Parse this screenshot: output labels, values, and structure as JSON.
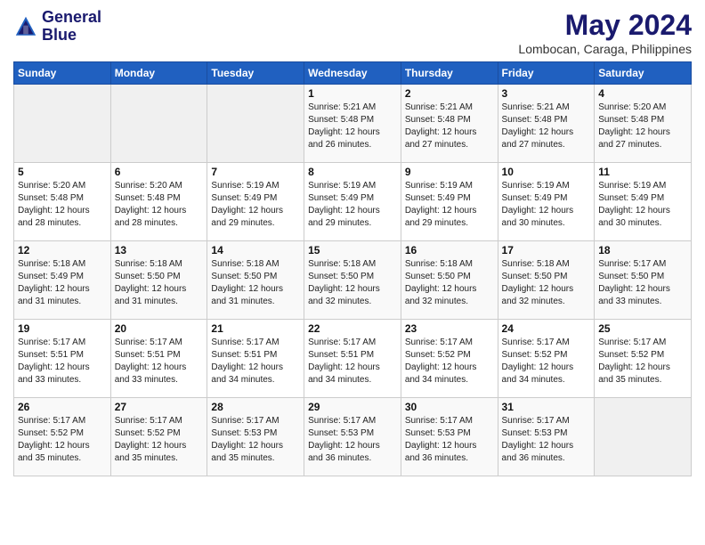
{
  "header": {
    "logo_line1": "General",
    "logo_line2": "Blue",
    "month": "May 2024",
    "location": "Lombocan, Caraga, Philippines"
  },
  "weekdays": [
    "Sunday",
    "Monday",
    "Tuesday",
    "Wednesday",
    "Thursday",
    "Friday",
    "Saturday"
  ],
  "weeks": [
    [
      {
        "day": "",
        "sunrise": "",
        "sunset": "",
        "daylight": ""
      },
      {
        "day": "",
        "sunrise": "",
        "sunset": "",
        "daylight": ""
      },
      {
        "day": "",
        "sunrise": "",
        "sunset": "",
        "daylight": ""
      },
      {
        "day": "1",
        "sunrise": "Sunrise: 5:21 AM",
        "sunset": "Sunset: 5:48 PM",
        "daylight": "Daylight: 12 hours and 26 minutes."
      },
      {
        "day": "2",
        "sunrise": "Sunrise: 5:21 AM",
        "sunset": "Sunset: 5:48 PM",
        "daylight": "Daylight: 12 hours and 27 minutes."
      },
      {
        "day": "3",
        "sunrise": "Sunrise: 5:21 AM",
        "sunset": "Sunset: 5:48 PM",
        "daylight": "Daylight: 12 hours and 27 minutes."
      },
      {
        "day": "4",
        "sunrise": "Sunrise: 5:20 AM",
        "sunset": "Sunset: 5:48 PM",
        "daylight": "Daylight: 12 hours and 27 minutes."
      }
    ],
    [
      {
        "day": "5",
        "sunrise": "Sunrise: 5:20 AM",
        "sunset": "Sunset: 5:48 PM",
        "daylight": "Daylight: 12 hours and 28 minutes."
      },
      {
        "day": "6",
        "sunrise": "Sunrise: 5:20 AM",
        "sunset": "Sunset: 5:48 PM",
        "daylight": "Daylight: 12 hours and 28 minutes."
      },
      {
        "day": "7",
        "sunrise": "Sunrise: 5:19 AM",
        "sunset": "Sunset: 5:49 PM",
        "daylight": "Daylight: 12 hours and 29 minutes."
      },
      {
        "day": "8",
        "sunrise": "Sunrise: 5:19 AM",
        "sunset": "Sunset: 5:49 PM",
        "daylight": "Daylight: 12 hours and 29 minutes."
      },
      {
        "day": "9",
        "sunrise": "Sunrise: 5:19 AM",
        "sunset": "Sunset: 5:49 PM",
        "daylight": "Daylight: 12 hours and 29 minutes."
      },
      {
        "day": "10",
        "sunrise": "Sunrise: 5:19 AM",
        "sunset": "Sunset: 5:49 PM",
        "daylight": "Daylight: 12 hours and 30 minutes."
      },
      {
        "day": "11",
        "sunrise": "Sunrise: 5:19 AM",
        "sunset": "Sunset: 5:49 PM",
        "daylight": "Daylight: 12 hours and 30 minutes."
      }
    ],
    [
      {
        "day": "12",
        "sunrise": "Sunrise: 5:18 AM",
        "sunset": "Sunset: 5:49 PM",
        "daylight": "Daylight: 12 hours and 31 minutes."
      },
      {
        "day": "13",
        "sunrise": "Sunrise: 5:18 AM",
        "sunset": "Sunset: 5:50 PM",
        "daylight": "Daylight: 12 hours and 31 minutes."
      },
      {
        "day": "14",
        "sunrise": "Sunrise: 5:18 AM",
        "sunset": "Sunset: 5:50 PM",
        "daylight": "Daylight: 12 hours and 31 minutes."
      },
      {
        "day": "15",
        "sunrise": "Sunrise: 5:18 AM",
        "sunset": "Sunset: 5:50 PM",
        "daylight": "Daylight: 12 hours and 32 minutes."
      },
      {
        "day": "16",
        "sunrise": "Sunrise: 5:18 AM",
        "sunset": "Sunset: 5:50 PM",
        "daylight": "Daylight: 12 hours and 32 minutes."
      },
      {
        "day": "17",
        "sunrise": "Sunrise: 5:18 AM",
        "sunset": "Sunset: 5:50 PM",
        "daylight": "Daylight: 12 hours and 32 minutes."
      },
      {
        "day": "18",
        "sunrise": "Sunrise: 5:17 AM",
        "sunset": "Sunset: 5:50 PM",
        "daylight": "Daylight: 12 hours and 33 minutes."
      }
    ],
    [
      {
        "day": "19",
        "sunrise": "Sunrise: 5:17 AM",
        "sunset": "Sunset: 5:51 PM",
        "daylight": "Daylight: 12 hours and 33 minutes."
      },
      {
        "day": "20",
        "sunrise": "Sunrise: 5:17 AM",
        "sunset": "Sunset: 5:51 PM",
        "daylight": "Daylight: 12 hours and 33 minutes."
      },
      {
        "day": "21",
        "sunrise": "Sunrise: 5:17 AM",
        "sunset": "Sunset: 5:51 PM",
        "daylight": "Daylight: 12 hours and 34 minutes."
      },
      {
        "day": "22",
        "sunrise": "Sunrise: 5:17 AM",
        "sunset": "Sunset: 5:51 PM",
        "daylight": "Daylight: 12 hours and 34 minutes."
      },
      {
        "day": "23",
        "sunrise": "Sunrise: 5:17 AM",
        "sunset": "Sunset: 5:52 PM",
        "daylight": "Daylight: 12 hours and 34 minutes."
      },
      {
        "day": "24",
        "sunrise": "Sunrise: 5:17 AM",
        "sunset": "Sunset: 5:52 PM",
        "daylight": "Daylight: 12 hours and 34 minutes."
      },
      {
        "day": "25",
        "sunrise": "Sunrise: 5:17 AM",
        "sunset": "Sunset: 5:52 PM",
        "daylight": "Daylight: 12 hours and 35 minutes."
      }
    ],
    [
      {
        "day": "26",
        "sunrise": "Sunrise: 5:17 AM",
        "sunset": "Sunset: 5:52 PM",
        "daylight": "Daylight: 12 hours and 35 minutes."
      },
      {
        "day": "27",
        "sunrise": "Sunrise: 5:17 AM",
        "sunset": "Sunset: 5:52 PM",
        "daylight": "Daylight: 12 hours and 35 minutes."
      },
      {
        "day": "28",
        "sunrise": "Sunrise: 5:17 AM",
        "sunset": "Sunset: 5:53 PM",
        "daylight": "Daylight: 12 hours and 35 minutes."
      },
      {
        "day": "29",
        "sunrise": "Sunrise: 5:17 AM",
        "sunset": "Sunset: 5:53 PM",
        "daylight": "Daylight: 12 hours and 36 minutes."
      },
      {
        "day": "30",
        "sunrise": "Sunrise: 5:17 AM",
        "sunset": "Sunset: 5:53 PM",
        "daylight": "Daylight: 12 hours and 36 minutes."
      },
      {
        "day": "31",
        "sunrise": "Sunrise: 5:17 AM",
        "sunset": "Sunset: 5:53 PM",
        "daylight": "Daylight: 12 hours and 36 minutes."
      },
      {
        "day": "",
        "sunrise": "",
        "sunset": "",
        "daylight": ""
      }
    ]
  ]
}
